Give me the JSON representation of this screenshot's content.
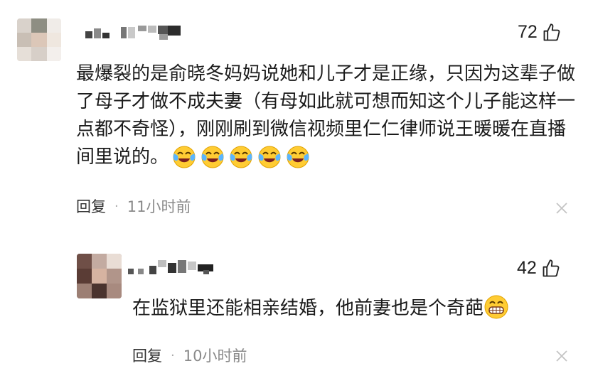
{
  "comments": [
    {
      "likes": "72",
      "text": "最爆裂的是俞晓冬妈妈说她和儿子才是正缘，只因为这辈子做了母子才做不成夫妻（有母如此就可想而知这个儿子能这样一点都不奇怪），刚刚刷到微信视频里仁仁律师说王暖暖在直播间里说的。",
      "reply_label": "回复",
      "separator": "·",
      "time": "11小时前",
      "emoji_icon": "laughing-crying-emoji-icon",
      "emoji_count": 5
    },
    {
      "likes": "42",
      "text": "在监狱里还能相亲结婚，他前妻也是个奇葩",
      "reply_label": "回复",
      "separator": "·",
      "time": "10小时前",
      "emoji_icon": "grinning-emoji-icon"
    }
  ],
  "icons": {
    "like": "thumbs-up-icon",
    "close": "close-icon"
  },
  "colors": {
    "text": "#1b1b1b",
    "meta": "#8a8a8a",
    "close": "#c4c4c4"
  }
}
